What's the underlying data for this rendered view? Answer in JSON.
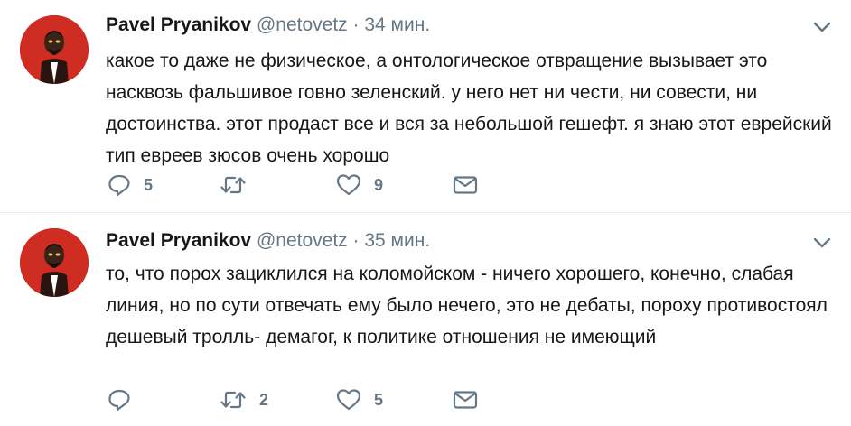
{
  "colors": {
    "avatar_bg": "#cf2d21",
    "text": "#14171a",
    "muted": "#657786",
    "divider": "#e6ecf0"
  },
  "tweets": [
    {
      "name": "Pavel Pryanikov",
      "handle": "@netovetz",
      "dot": "·",
      "time": "34 мин.",
      "text": "какое то даже не физическое, а онтологическое отвращение вызывает это насквозь фальшивое говно зеленский. у него нет ни чести, ни совести, ни достоинства. этот продаст все и вся за небольшой гешефт. я знаю этот еврейский тип евреев зюсов очень хорошо",
      "replies": "5",
      "retweets": "",
      "likes": "9",
      "icons": {
        "reply": "reply-icon",
        "retweet": "retweet-icon",
        "like": "heart-icon",
        "dm": "envelope-icon",
        "menu": "chevron-down-icon"
      }
    },
    {
      "name": "Pavel Pryanikov",
      "handle": "@netovetz",
      "dot": "·",
      "time": "35 мин.",
      "text": "то, что порох зациклился на коломойском - ничего хорошего, конечно, слабая линия, но по сути отвечать ему было нечего, это не дебаты, пороху противостоял дешевый тролль- демагог, к политике отношения не имеющий",
      "replies": "",
      "retweets": "2",
      "likes": "5",
      "icons": {
        "reply": "reply-icon",
        "retweet": "retweet-icon",
        "like": "heart-icon",
        "dm": "envelope-icon",
        "menu": "chevron-down-icon"
      }
    }
  ]
}
